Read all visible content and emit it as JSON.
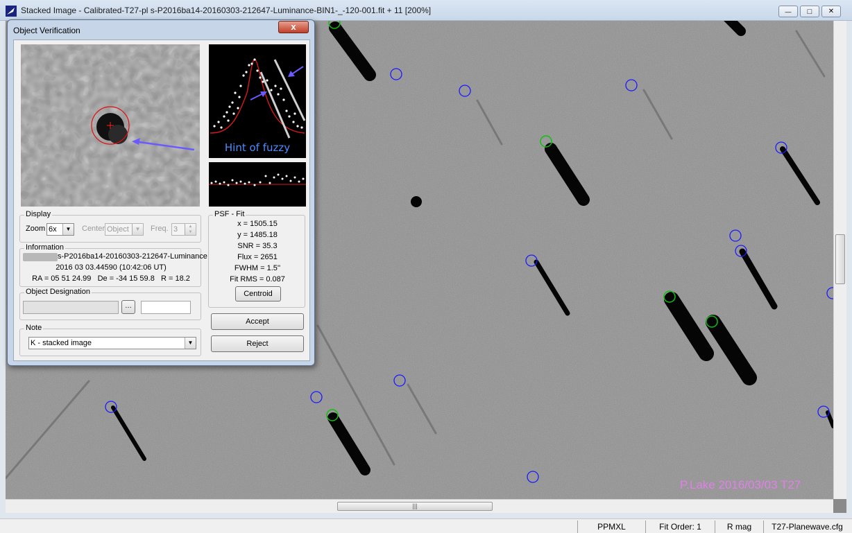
{
  "window": {
    "title": "Stacked Image - Calibrated-T27-pl                s-P2016ba14-20160303-212647-Luminance-BIN1-_-120-001.fit + 11 [200%]",
    "minimize_glyph": "—",
    "maximize_glyph": "□",
    "close_glyph": "✕"
  },
  "signature": "P.Lake 2016/03/03 T27",
  "statusbar": {
    "catalog": "PPMXL",
    "fit_order": "Fit Order: 1",
    "mag_band": "R mag",
    "config": "T27-Planewave.cfg"
  },
  "dialog": {
    "title": "Object Verification",
    "close_glyph": "x",
    "psf_graph": {
      "annotation": "Hint of fuzzy"
    },
    "display": {
      "label": "Display",
      "zoom_label": "Zoom",
      "zoom_value": "6x",
      "center_label": "Center",
      "center_value": "Object",
      "freq_label": "Freq.",
      "freq_value": "3"
    },
    "information": {
      "label": "Information",
      "image_name": "s-P2016ba14-20160303-212647-Luminance",
      "datetime": "2016 03 03.44590 (10:42:06 UT)",
      "coords": "RA = 05 51 24.99   De = -34 15 59.8   R = 18.2"
    },
    "object_designation": {
      "label": "Object Designation",
      "lookup_glyph": "…"
    },
    "note": {
      "label": "Note",
      "value": "K - stacked image"
    },
    "psf_fit": {
      "label": "PSF - Fit",
      "x": "x = 1505.15",
      "y": "y = 1485.18",
      "snr": "SNR = 35.3",
      "flux": "Flux = 2651",
      "fwhm": "FWHM = 1.5''",
      "fit_rms": "Fit RMS = 0.087",
      "centroid": "Centroid"
    },
    "accept": "Accept",
    "reject": "Reject"
  },
  "colors": {
    "known_object_circle": "#1a1aff",
    "reference_star_circle": "#10c010",
    "psf_curve": "#d81818",
    "annotation_text": "#4a8cff",
    "annotation_arrow": "#6a5aff",
    "signature": "#e080e8"
  }
}
